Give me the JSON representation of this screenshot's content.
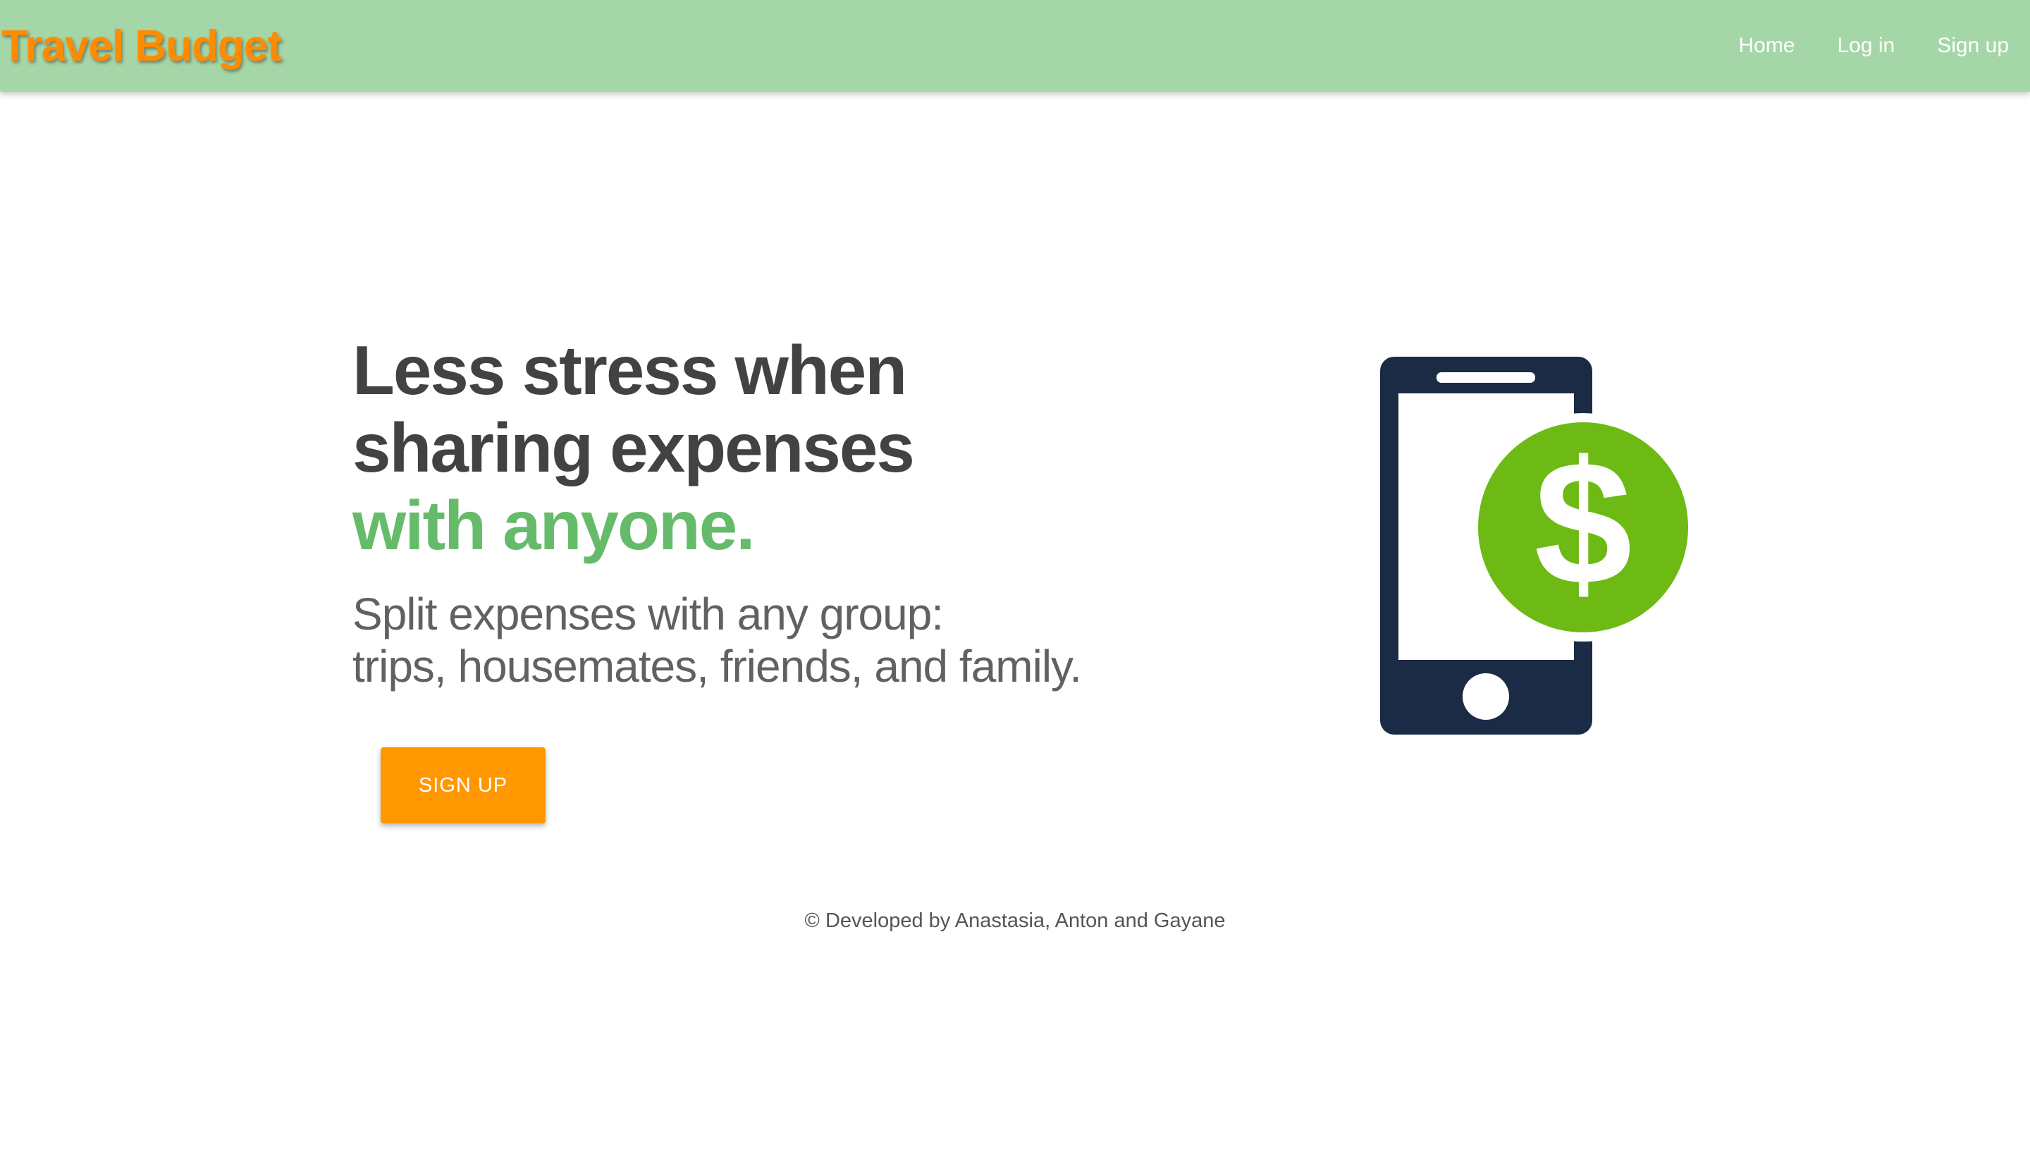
{
  "navbar": {
    "brand": "Travel Budget",
    "links": [
      "Home",
      "Log in",
      "Sign up"
    ]
  },
  "hero": {
    "headline_lines": [
      "Less stress when",
      "sharing expenses"
    ],
    "headline_accent": "with anyone.",
    "subtitle_lines": [
      "Split expenses with any group:",
      "trips, housemates, friends, and family."
    ],
    "cta_label": "SIGN UP",
    "illustration_icon": "phone-dollar-icon"
  },
  "footer": {
    "text": "© Developed by Anastasia, Anton and Gayane"
  },
  "colors": {
    "navbar_bg": "#a5d6a7",
    "brand": "#ff8c00",
    "headline": "#424242",
    "accent": "#66bb6a",
    "cta_bg": "#ff9800",
    "phone": "#1c2b45",
    "coin": "#6dba14"
  }
}
